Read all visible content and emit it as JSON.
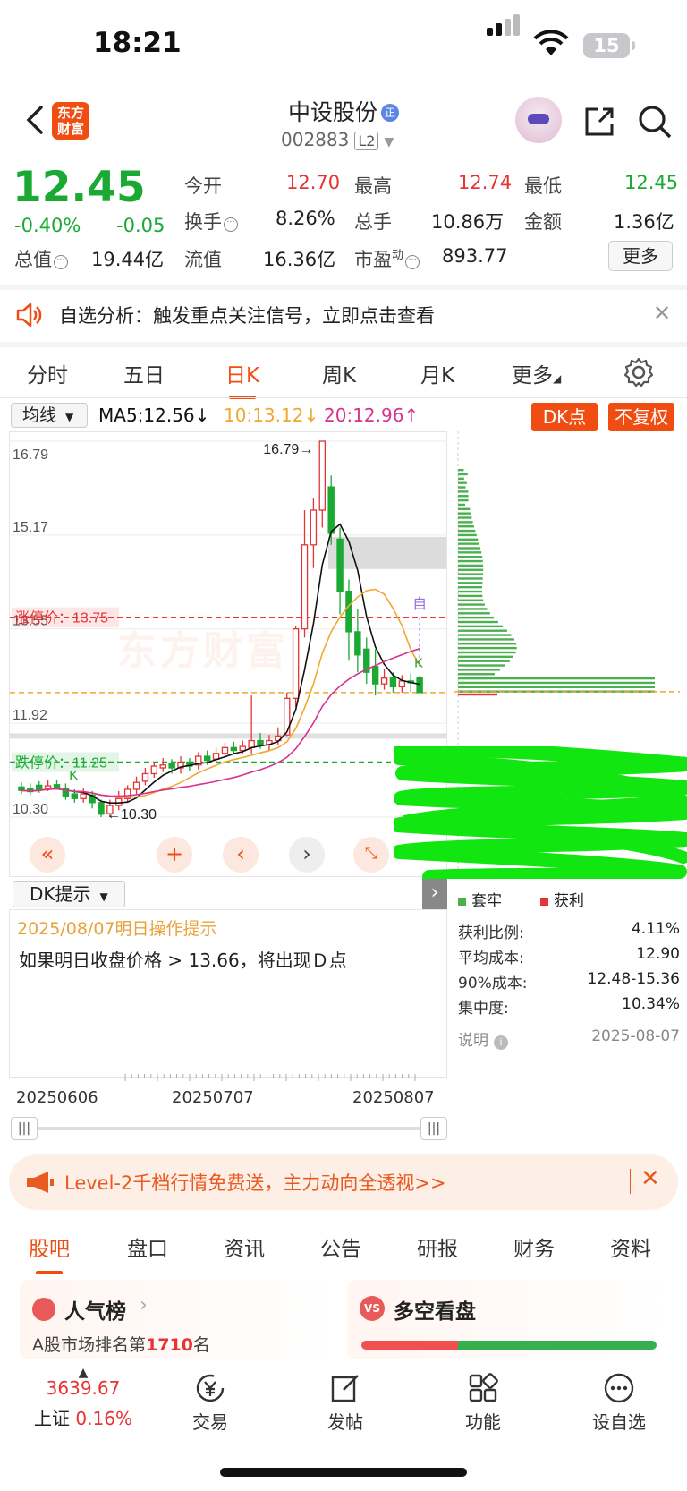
{
  "status_bar": {
    "time": "18:21",
    "battery": "15"
  },
  "nav": {
    "logo_line1": "东方",
    "logo_line2": "财富",
    "stock_name": "中设股份",
    "stock_badge": "正",
    "stock_code": "002883",
    "level": "L2"
  },
  "quote": {
    "price": "12.45",
    "change_pct": "-0.40%",
    "change": "-0.05",
    "open_label": "今开",
    "open": "12.70",
    "high_label": "最高",
    "high": "12.74",
    "low_label": "最低",
    "low": "12.45",
    "turnover_label": "换手",
    "turnover": "8.26%",
    "volume_label": "总手",
    "volume": "10.86万",
    "amount_label": "金额",
    "amount": "1.36亿",
    "mktcap_label": "总值",
    "mktcap": "19.44亿",
    "float_label": "流值",
    "float": "16.36亿",
    "pe_label": "市盈",
    "pe_sup": "动",
    "pe": "893.77",
    "more": "更多"
  },
  "alert": {
    "text": "自选分析：触发重点关注信号，立即点击查看"
  },
  "chart_tabs": [
    "分时",
    "五日",
    "日K",
    "周K",
    "月K",
    "更多"
  ],
  "ma_row": {
    "selector": "均线",
    "ma5": "MA5:12.56↓",
    "ma10": "10:13.12↓",
    "ma20": "20:12.96↑",
    "dk_button": "DK点",
    "adjust_button": "不复权"
  },
  "colors": {
    "accent": "#f04d12",
    "up": "#e63333",
    "down": "#1aaa33",
    "ma5": "#111111",
    "ma10": "#f0a830",
    "ma20": "#d6338f"
  },
  "chart_data": {
    "type": "candlestick",
    "y_ticks": [
      "16.79",
      "15.17",
      "13.55",
      "11.92",
      "10.30"
    ],
    "ylim": [
      10.3,
      16.79
    ],
    "max_label": "16.79→",
    "min_label": "←10.30",
    "limit_up_label": "涨停价：13.75",
    "limit_down_label": "跌停价：11.25",
    "limit_up": 13.75,
    "limit_down": 11.25,
    "current_line": 12.45,
    "watermark": "东方财富",
    "marker_k": "K",
    "marker_zi": "自",
    "x_dates": [
      "20250606",
      "20250707",
      "20250807"
    ],
    "candles": [
      {
        "o": 10.82,
        "c": 10.76,
        "h": 10.9,
        "l": 10.7
      },
      {
        "o": 10.8,
        "c": 10.74,
        "h": 10.88,
        "l": 10.68
      },
      {
        "o": 10.85,
        "c": 10.78,
        "h": 10.92,
        "l": 10.72
      },
      {
        "o": 10.8,
        "c": 10.84,
        "h": 10.95,
        "l": 10.75
      },
      {
        "o": 10.86,
        "c": 10.82,
        "h": 10.95,
        "l": 10.78
      },
      {
        "o": 10.8,
        "c": 10.65,
        "h": 10.88,
        "l": 10.6
      },
      {
        "o": 10.7,
        "c": 10.62,
        "h": 10.78,
        "l": 10.55
      },
      {
        "o": 10.62,
        "c": 10.7,
        "h": 10.8,
        "l": 10.55
      },
      {
        "o": 10.68,
        "c": 10.55,
        "h": 10.75,
        "l": 10.45
      },
      {
        "o": 10.55,
        "c": 10.35,
        "h": 10.6,
        "l": 10.3
      },
      {
        "o": 10.36,
        "c": 10.5,
        "h": 10.6,
        "l": 10.3
      },
      {
        "o": 10.5,
        "c": 10.62,
        "h": 10.75,
        "l": 10.42
      },
      {
        "o": 10.62,
        "c": 10.78,
        "h": 10.85,
        "l": 10.55
      },
      {
        "o": 10.78,
        "c": 10.9,
        "h": 11.0,
        "l": 10.7
      },
      {
        "o": 10.92,
        "c": 11.05,
        "h": 11.15,
        "l": 10.85
      },
      {
        "o": 11.05,
        "c": 11.18,
        "h": 11.25,
        "l": 10.98
      },
      {
        "o": 11.15,
        "c": 11.2,
        "h": 11.32,
        "l": 11.08
      },
      {
        "o": 11.22,
        "c": 11.15,
        "h": 11.3,
        "l": 11.05
      },
      {
        "o": 11.15,
        "c": 11.25,
        "h": 11.35,
        "l": 11.05
      },
      {
        "o": 11.25,
        "c": 11.18,
        "h": 11.32,
        "l": 11.1
      },
      {
        "o": 11.2,
        "c": 11.35,
        "h": 11.42,
        "l": 11.12
      },
      {
        "o": 11.35,
        "c": 11.28,
        "h": 11.45,
        "l": 11.2
      },
      {
        "o": 11.3,
        "c": 11.4,
        "h": 11.5,
        "l": 11.22
      },
      {
        "o": 11.4,
        "c": 11.5,
        "h": 11.58,
        "l": 11.32
      },
      {
        "o": 11.5,
        "c": 11.45,
        "h": 11.6,
        "l": 11.38
      },
      {
        "o": 11.45,
        "c": 11.52,
        "h": 11.62,
        "l": 11.4
      },
      {
        "o": 11.5,
        "c": 11.62,
        "h": 12.4,
        "l": 11.4
      },
      {
        "o": 11.62,
        "c": 11.55,
        "h": 11.75,
        "l": 11.48
      },
      {
        "o": 11.55,
        "c": 11.62,
        "h": 11.72,
        "l": 11.45
      },
      {
        "o": 11.62,
        "c": 11.7,
        "h": 11.85,
        "l": 11.55
      },
      {
        "o": 11.72,
        "c": 12.35,
        "h": 12.45,
        "l": 11.7
      },
      {
        "o": 12.35,
        "c": 13.55,
        "h": 13.6,
        "l": 12.2
      },
      {
        "o": 13.55,
        "c": 15.0,
        "h": 15.6,
        "l": 13.4
      },
      {
        "o": 15.0,
        "c": 15.6,
        "h": 15.8,
        "l": 14.6
      },
      {
        "o": 15.6,
        "c": 16.79,
        "h": 16.79,
        "l": 15.3
      },
      {
        "o": 16.0,
        "c": 15.2,
        "h": 16.2,
        "l": 15.0
      },
      {
        "o": 15.1,
        "c": 14.2,
        "h": 15.3,
        "l": 13.8
      },
      {
        "o": 14.2,
        "c": 13.5,
        "h": 14.4,
        "l": 13.0
      },
      {
        "o": 13.5,
        "c": 13.1,
        "h": 13.9,
        "l": 12.8
      },
      {
        "o": 13.2,
        "c": 12.8,
        "h": 13.4,
        "l": 12.6
      },
      {
        "o": 12.9,
        "c": 12.6,
        "h": 13.2,
        "l": 12.4
      },
      {
        "o": 12.6,
        "c": 12.7,
        "h": 12.85,
        "l": 12.5
      },
      {
        "o": 12.7,
        "c": 12.55,
        "h": 12.8,
        "l": 12.45
      },
      {
        "o": 12.55,
        "c": 12.65,
        "h": 12.75,
        "l": 12.45
      },
      {
        "o": 12.65,
        "c": 12.62,
        "h": 12.78,
        "l": 12.45
      },
      {
        "o": 12.7,
        "c": 12.45,
        "h": 12.74,
        "l": 12.45
      }
    ]
  },
  "dk": {
    "selector": "DK提示",
    "date_line": "2025/08/07明日操作提示",
    "message": "如果明日收盘价格 > 13.66，将出现Ｄ点"
  },
  "chip_legend": {
    "trapped": "套牢",
    "profit": "获利"
  },
  "chip_stats": [
    {
      "k": "获利比例:",
      "v": "4.11%"
    },
    {
      "k": "平均成本:",
      "v": "12.90"
    },
    {
      "k": "90%成本:",
      "v": "12.48-15.36"
    },
    {
      "k": "集中度:",
      "v": "10.34%"
    },
    {
      "k": "说明",
      "v": "2025-08-07"
    }
  ],
  "promo": {
    "text": "Level-2千档行情免费送，主力动向全透视>>"
  },
  "bottom_tabs": [
    "股吧",
    "盘口",
    "资讯",
    "公告",
    "研报",
    "财务",
    "资料"
  ],
  "cards": {
    "popular_title": "人气榜",
    "popular_rank_prefix": "A股市场排名第",
    "popular_rank": "1710",
    "popular_rank_suffix": "名",
    "vs_title": "多空看盘",
    "vs_badge": "VS"
  },
  "dock": {
    "index_value": "3639.67",
    "index_name": "上证",
    "index_change": "0.16%",
    "items": [
      "交易",
      "发帖",
      "功能",
      "设自选"
    ]
  }
}
